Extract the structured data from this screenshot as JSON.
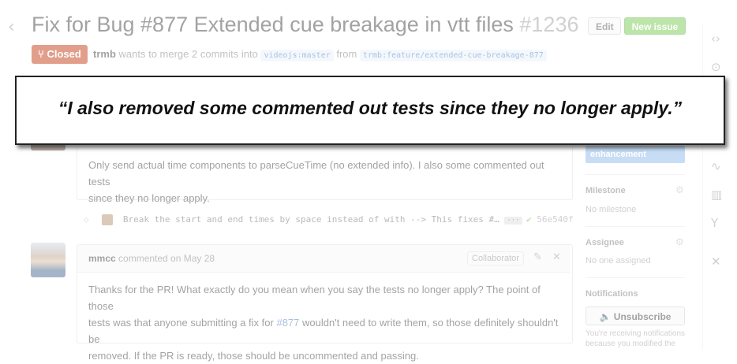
{
  "header": {
    "title": "Fix for Bug #877 Extended cue breakage in vtt files",
    "number": "#1236",
    "edit_label": "Edit",
    "new_issue_label": "New issue"
  },
  "state": {
    "label": "Closed",
    "author": "trmb",
    "merge_text_1": "wants to merge 2 commits into",
    "base_ref": "videojs:master",
    "merge_text_2": "from",
    "head_ref": "trmb:feature/extended-cue-breakage-877"
  },
  "quote": {
    "text": "“I also removed some commented out tests since they no longer apply.”"
  },
  "first_comment": {
    "line1": "Only send actual time components to parseCueTime (no extended info). I also some commented out tests",
    "line2": "since they no longer apply."
  },
  "commit": {
    "message": "Break the start and end times by space instead of with --> This fixes #…",
    "more": "···",
    "sha": "56e540f",
    "status": "✔"
  },
  "second_comment": {
    "author": "mmcc",
    "meta": "commented on May 28",
    "badge": "Collaborator",
    "line1": "Thanks for the PR! What exactly do you mean when you say the tests no longer apply? The point of those",
    "line2_a": "tests was that anyone submitting a fix for",
    "line2_link": "#877",
    "line2_b": "wouldn't need to write them, so those definitely shouldn't be",
    "line3": "removed. If the PR is ready, those should be uncommented and passing."
  },
  "sidebar": {
    "label": "enhancement",
    "label_color": "#84b6eb",
    "milestone_title": "Milestone",
    "milestone_value": "No milestone",
    "assignee_title": "Assignee",
    "assignee_value": "No one assigned",
    "notifications_title": "Notifications",
    "unsubscribe_label": "🔈 Unsubscribe",
    "notif_line1": "You're receiving notifications",
    "notif_line2": "because you modified the"
  },
  "colors": {
    "closed": "#bd2c00",
    "new_issue": "#6cc644",
    "link": "#4078c0"
  },
  "icons": [
    "chevron-left-icon",
    "code-icon",
    "issue-icon",
    "pulse-icon",
    "graph-icon",
    "fork-icon",
    "tools-icon",
    "gear-icon",
    "pencil-icon",
    "close-icon",
    "check-icon",
    "mute-icon"
  ]
}
